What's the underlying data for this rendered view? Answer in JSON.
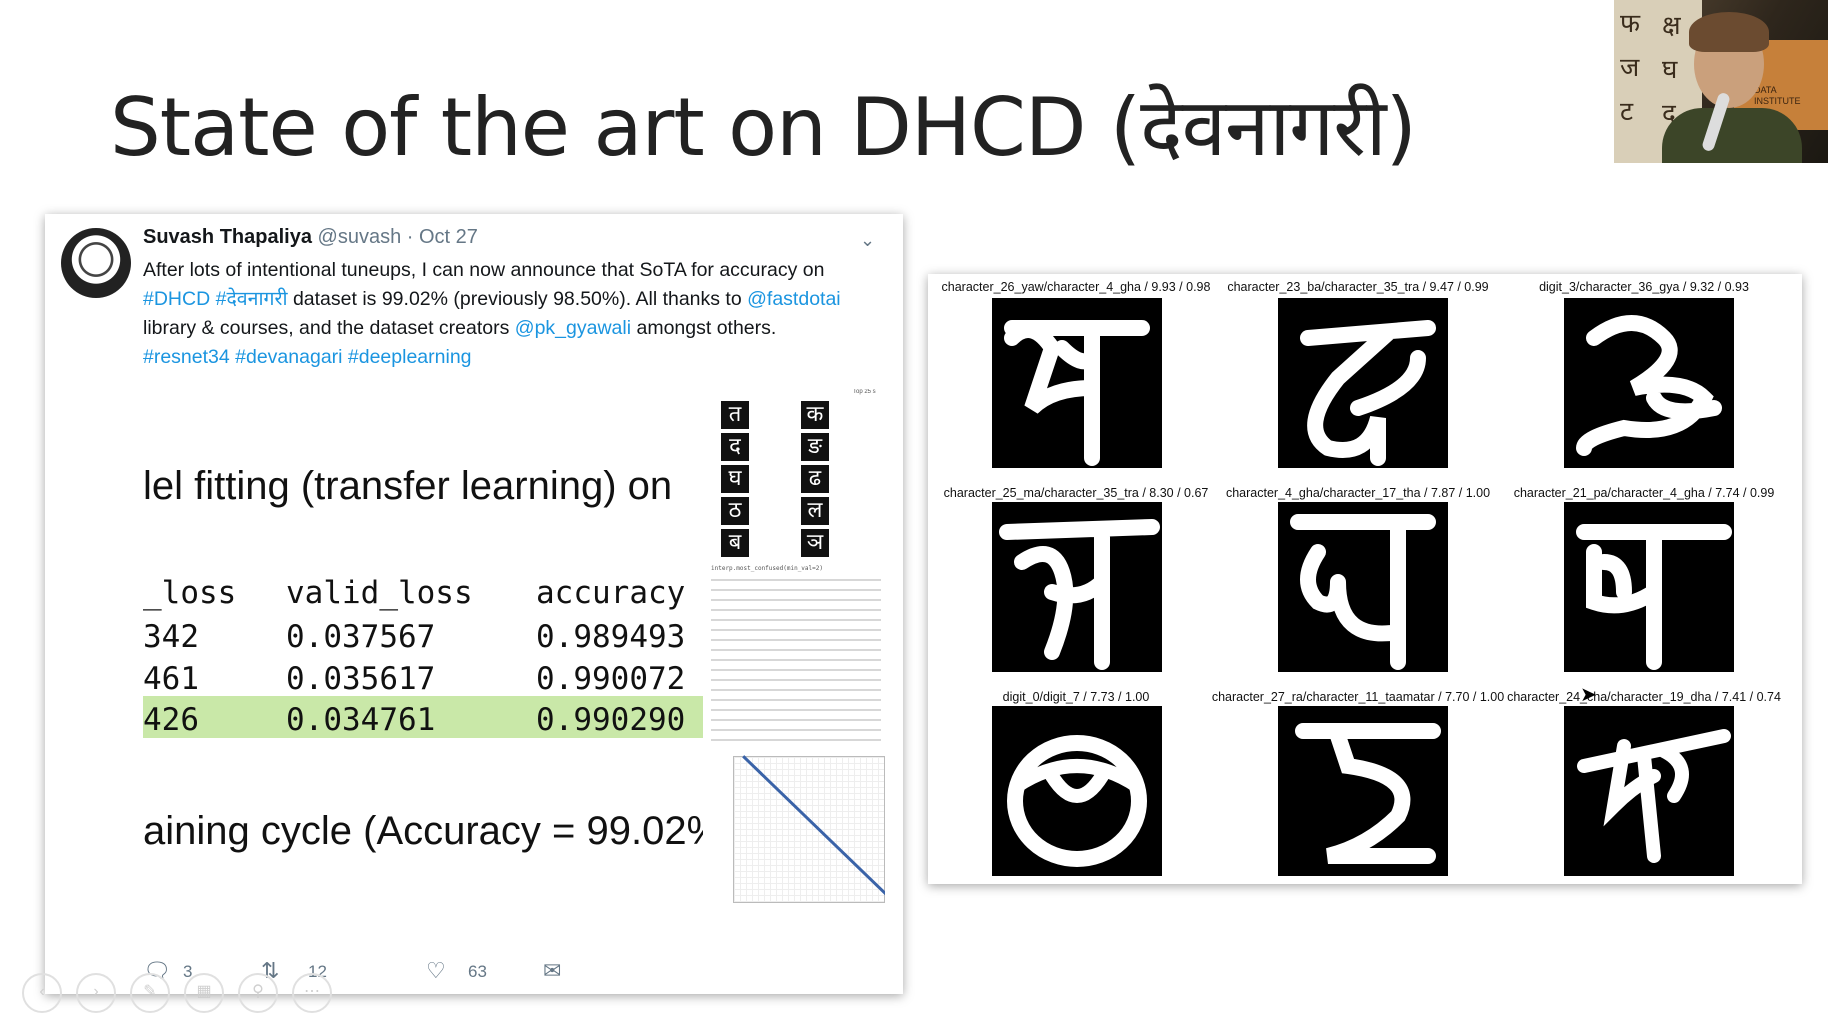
{
  "slide": {
    "title": "State of the art on DHCD (देवनागरी)"
  },
  "tweet": {
    "author_name": "Suvash Thapaliya",
    "handle": "@suvash",
    "date": "· Oct 27",
    "text_part1": "After lots of intentional tuneups, I can now announce that SoTA for accuracy on ",
    "link_dhcd": "#DHCD",
    "link_deva": "#देवनागरी",
    "text_part2": " dataset is 99.02% (previously 98.50%). All thanks to ",
    "link_fastdotai": "@fastdotai",
    "text_part3": " library & courses, and the dataset creators ",
    "link_pk": "@pk_gyawali",
    "text_part4": " amongst others.",
    "hashtags": "#resnet34 #devanagari #deeplearning",
    "reply_count": "3",
    "retweet_count": "12",
    "like_count": "63"
  },
  "tweet_image": {
    "heading": "lel fitting (transfer learning) on",
    "table": {
      "headers": [
        "_loss",
        "valid_loss",
        "accuracy"
      ],
      "rows": [
        [
          "342",
          "0.037567",
          "0.989493"
        ],
        [
          "461",
          "0.035617",
          "0.990072"
        ],
        [
          "426",
          "0.034761",
          "0.990290"
        ]
      ]
    },
    "footer": "aining cycle (Accuracy = 99.02%",
    "mini_top_label": "Top 25 s",
    "mini_code": "interp.most_confused(min_val=2)",
    "mini_glyphs": [
      "त",
      "क",
      "द",
      "ङ",
      "घ",
      "ढ",
      "ठ",
      "ल",
      "ब",
      "ञ"
    ]
  },
  "predictions": [
    {
      "label": "character_26_yaw/character_4_gha / 9.93 / 0.98"
    },
    {
      "label": "character_23_ba/character_35_tra / 9.47 / 0.99"
    },
    {
      "label": "digit_3/character_36_gya / 9.32 / 0.93"
    },
    {
      "label": "character_25_ma/character_35_tra / 8.30 / 0.67"
    },
    {
      "label": "character_4_gha/character_17_tha / 7.87 / 1.00"
    },
    {
      "label": "character_21_pa/character_4_gha / 7.74 / 0.99"
    },
    {
      "label": "digit_0/digit_7 / 7.73 / 1.00"
    },
    {
      "label": "character_27_ra/character_11_taamatar / 7.70 / 1.00"
    },
    {
      "label": "character_24_cha/character_19_dha / 7.41 / 0.74"
    }
  ],
  "player_controls": [
    "back-icon",
    "forward-icon",
    "pen-icon",
    "slides-icon",
    "zoom-icon",
    "more-icon"
  ]
}
